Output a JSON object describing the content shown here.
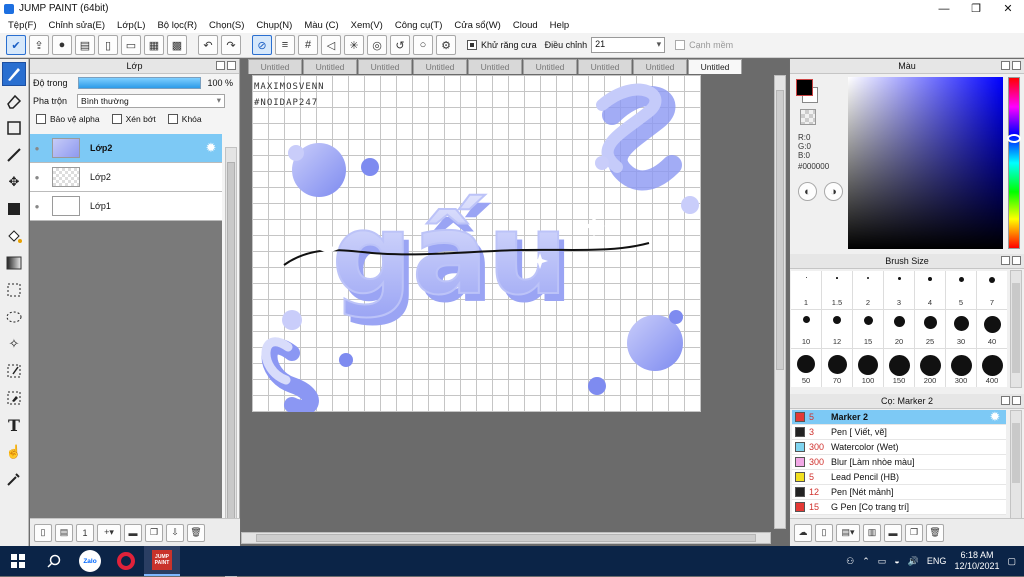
{
  "window": {
    "title": "JUMP PAINT (64bit)",
    "minimize": "—",
    "maximize": "❐",
    "close": "✕"
  },
  "menu": [
    "Tệp(F)",
    "Chỉnh sửa(E)",
    "Lớp(L)",
    "Bộ lọc(R)",
    "Chọn(S)",
    "Chụp(N)",
    "Màu (C)",
    "Xem(V)",
    "Công cụ(T)",
    "Cửa sổ(W)",
    "Cloud",
    "Help"
  ],
  "toolbar": {
    "antialias_label": "Khử răng cưa",
    "adjust_label": "Điều chỉnh",
    "adjust_value": "21",
    "edge_label": "Cạnh mềm"
  },
  "layer_panel": {
    "title": "Lớp",
    "opacity_label": "Độ trong",
    "opacity_value": "100 %",
    "opacity": 1.0,
    "blend_label": "Pha trộn",
    "blend_value": "Bình thường",
    "protect_alpha": "Bảo vệ alpha",
    "clipping": "Xén bớt",
    "lock": "Khóa",
    "layers": [
      {
        "name": "Lớp2",
        "selected": true
      },
      {
        "name": "Lớp2",
        "selected": false
      },
      {
        "name": "Lớp1",
        "selected": false
      }
    ]
  },
  "tabs": [
    "Untitled",
    "Untitled",
    "Untitled",
    "Untitled",
    "Untitled",
    "Untitled",
    "Untitled",
    "Untitled",
    "Untitled"
  ],
  "artwork": {
    "watermark_line1": "MAXIMOSVENN",
    "watermark_line2": "#NOIDAP247",
    "script_text": "gấu"
  },
  "color_panel": {
    "title": "Màu",
    "r": "R:0",
    "g": "G:0",
    "b": "B:0",
    "hex": "#000000",
    "primary": "#000000"
  },
  "brush_panel": {
    "title": "Brush Size",
    "sizes": [
      "1",
      "1.5",
      "2",
      "3",
      "4",
      "5",
      "7",
      "10",
      "12",
      "15",
      "20",
      "25",
      "30",
      "40",
      "50",
      "70",
      "100",
      "150",
      "200",
      "300",
      "400"
    ]
  },
  "tool_list": {
    "title": "Cọ: Marker 2",
    "items": [
      {
        "size": "5",
        "name": "Marker 2",
        "color": "#e53935",
        "selected": true
      },
      {
        "size": "3",
        "name": "Pen [ Viết, vẽ]",
        "color": "#222222",
        "selected": false
      },
      {
        "size": "300",
        "name": "Watercolor (Wet)",
        "color": "#7fd4f0",
        "selected": false
      },
      {
        "size": "300",
        "name": "Blur [Làm nhòe màu]",
        "color": "#f2a8e6",
        "selected": false
      },
      {
        "size": "5",
        "name": "Lead Pencil (HB)",
        "color": "#f2e020",
        "selected": false
      },
      {
        "size": "12",
        "name": "Pen [Nét mảnh]",
        "color": "#222222",
        "selected": false
      },
      {
        "size": "15",
        "name": "G Pen [Cọ trang trí]",
        "color": "#e53935",
        "selected": false
      }
    ]
  },
  "taskbar": {
    "language": "ENG",
    "time": "6:18 AM",
    "date": "12/10/2021",
    "zalo": "Zalo",
    "app": "JUMP PAINT"
  }
}
